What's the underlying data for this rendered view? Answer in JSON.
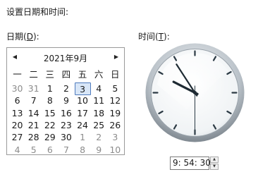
{
  "heading": "设置日期和时间:",
  "date_label": {
    "text": "日期(",
    "accel": "D",
    "suffix": "):"
  },
  "time_label": {
    "text": "时间(",
    "accel": "T",
    "suffix": "):"
  },
  "calendar": {
    "title": "2021年9月",
    "prev_icon": "◀",
    "next_icon": "▶",
    "weekdays": [
      "一",
      "二",
      "三",
      "四",
      "五",
      "六",
      "日"
    ],
    "weeks": [
      [
        "30",
        "31",
        "1",
        "2",
        "3",
        "4",
        "5"
      ],
      [
        "6",
        "7",
        "8",
        "9",
        "10",
        "11",
        "12"
      ],
      [
        "13",
        "14",
        "15",
        "16",
        "17",
        "18",
        "19"
      ],
      [
        "20",
        "21",
        "22",
        "23",
        "24",
        "25",
        "26"
      ],
      [
        "27",
        "28",
        "29",
        "30",
        "1",
        "2",
        "3"
      ],
      [
        "4",
        "5",
        "6",
        "7",
        "8",
        "9",
        "10"
      ]
    ],
    "selected": "3"
  },
  "clock": {
    "hour": 9,
    "minute": 54,
    "second": 30
  },
  "time_value": "9: 54: 30",
  "spin": {
    "up_icon": "▲",
    "down_icon": "▼"
  }
}
